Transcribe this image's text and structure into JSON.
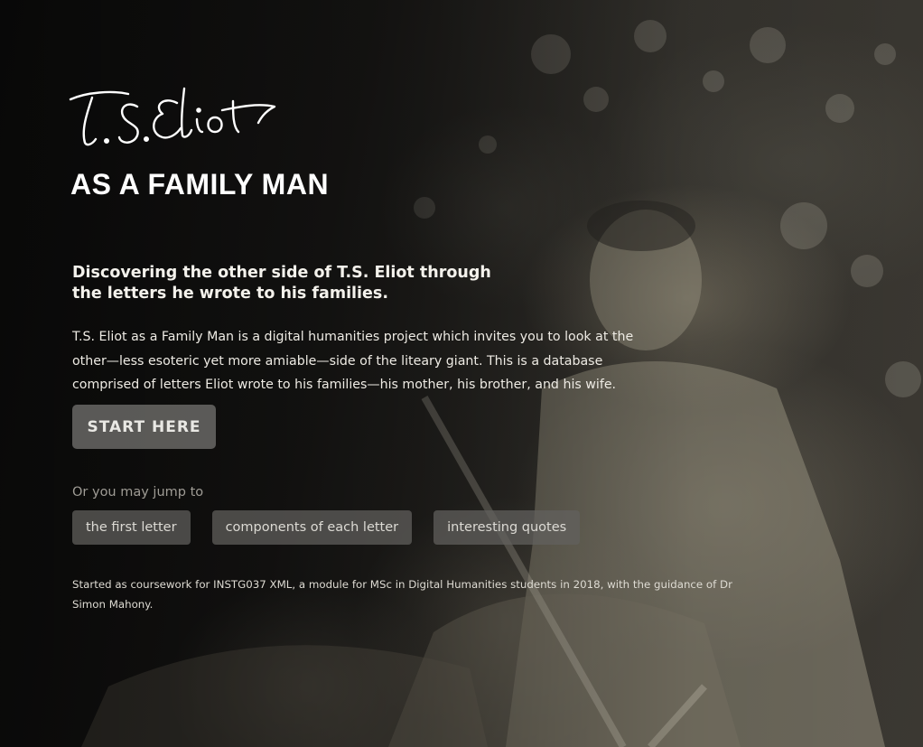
{
  "brand": {
    "signature_text": "T.S. Eliot",
    "subtitle": "AS A FAMILY MAN"
  },
  "intro": {
    "lead": "Discovering the other side of T.S. Eliot through the letters he wrote to his families.",
    "description": "T.S. Eliot as a Family Man is a digital humanities project which invites you to look at the other—less esoteric yet more amiable—side of the liteary giant. This is a database comprised of letters Eliot wrote to his families—his mother, his brother, and his wife."
  },
  "cta": {
    "start_label": "START HERE"
  },
  "jump": {
    "label": "Or you may jump to",
    "links": [
      {
        "label": "the first letter"
      },
      {
        "label": "components of each letter"
      },
      {
        "label": "interesting quotes"
      }
    ]
  },
  "footer": {
    "note": "Started as coursework for INSTG037 XML, a module for MSc in Digital Humanities students in 2018, with the guidance of Dr Simon Mahony."
  },
  "colors": {
    "button_bg": "#807f7c",
    "link_bg": "#62615e",
    "text": "#f2f0ea"
  }
}
